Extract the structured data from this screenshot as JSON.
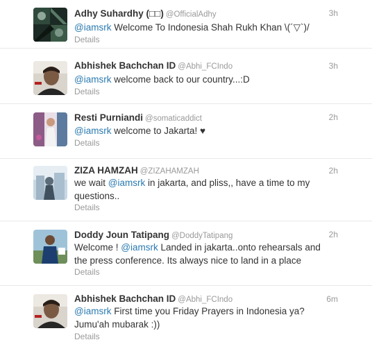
{
  "tweets": [
    {
      "name": "Adhy Suhardhy (□□)",
      "handle": "@OfficialAdhy",
      "time": "3h",
      "before": "",
      "mention": "@iamsrk",
      "after": " Welcome To Indonesia Shah Rukh Khan \\(´▽`)/",
      "details": "Details"
    },
    {
      "name": "Abhishek Bachchan ID",
      "handle": "@Abhi_FCIndo",
      "time": "3h",
      "before": "",
      "mention": "@iamsrk",
      "after": " welcome back to our country...:D",
      "details": "Details"
    },
    {
      "name": "Resti Purniandi",
      "handle": "@somaticaddict",
      "time": "2h",
      "before": "",
      "mention": "@iamsrk",
      "after": " welcome to Jakarta! ♥",
      "details": "Details"
    },
    {
      "name": "ZIZA HAMZAH",
      "handle": "@ZIZAHAMZAH",
      "time": "2h",
      "before": "we wait ",
      "mention": "@iamsrk",
      "after": " in jakarta, and pliss,, have a time to my questions..",
      "details": "Details"
    },
    {
      "name": "Doddy Joun Tatipang",
      "handle": "@DoddyTatipang",
      "time": "2h",
      "before": "Welcome ! ",
      "mention": "@iamsrk",
      "after": " Landed in jakarta..onto rehearsals and the press conference. Its always nice to land in a place",
      "details": "Details"
    },
    {
      "name": "Abhishek Bachchan ID",
      "handle": "@Abhi_FCIndo",
      "time": "6m",
      "before": "",
      "mention": "@iamsrk",
      "after": " First time you Friday Prayers in Indonesia ya? Jumu'ah mubarak :))",
      "details": "Details"
    }
  ]
}
